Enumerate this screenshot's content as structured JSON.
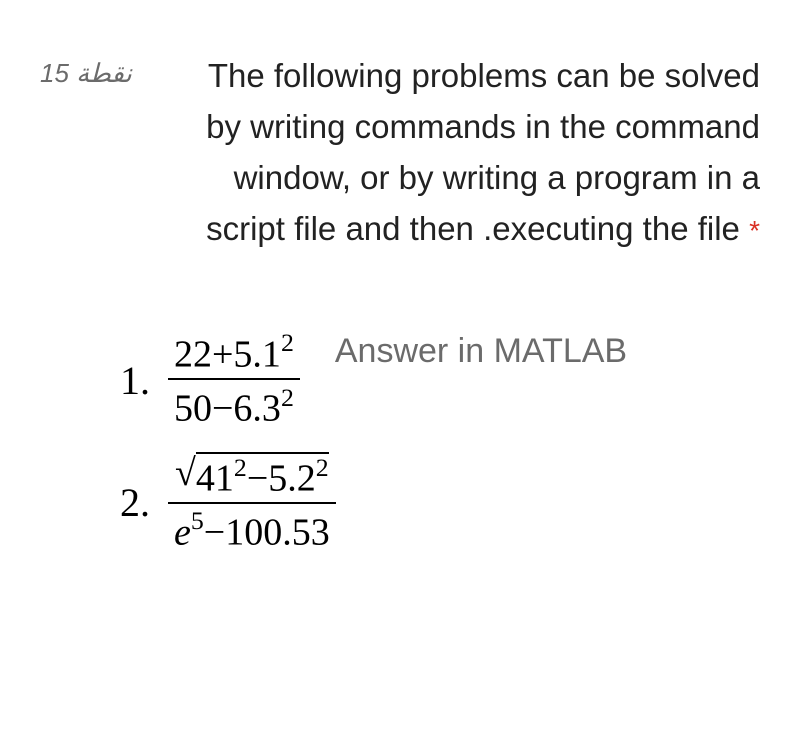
{
  "points_label": "15 نقطة",
  "question_text": "The following problems can be solved by writing commands in the command window, or by writing a program in a script file and then .executing the file",
  "required_marker": "*",
  "annotation": "Answer in MATLAB",
  "problems": [
    {
      "number": "1.",
      "numerator": "22+5.1",
      "numerator_exp": "2",
      "denominator": "50−6.3",
      "denominator_exp": "2"
    },
    {
      "number": "2.",
      "numerator_sqrt_inner_a": "41",
      "numerator_sqrt_exp_a": "2",
      "numerator_sqrt_sep": "−5.2",
      "numerator_sqrt_exp_b": "2",
      "denominator_base": "e",
      "denominator_exp": "5",
      "denominator_rest": "−100.53"
    }
  ]
}
